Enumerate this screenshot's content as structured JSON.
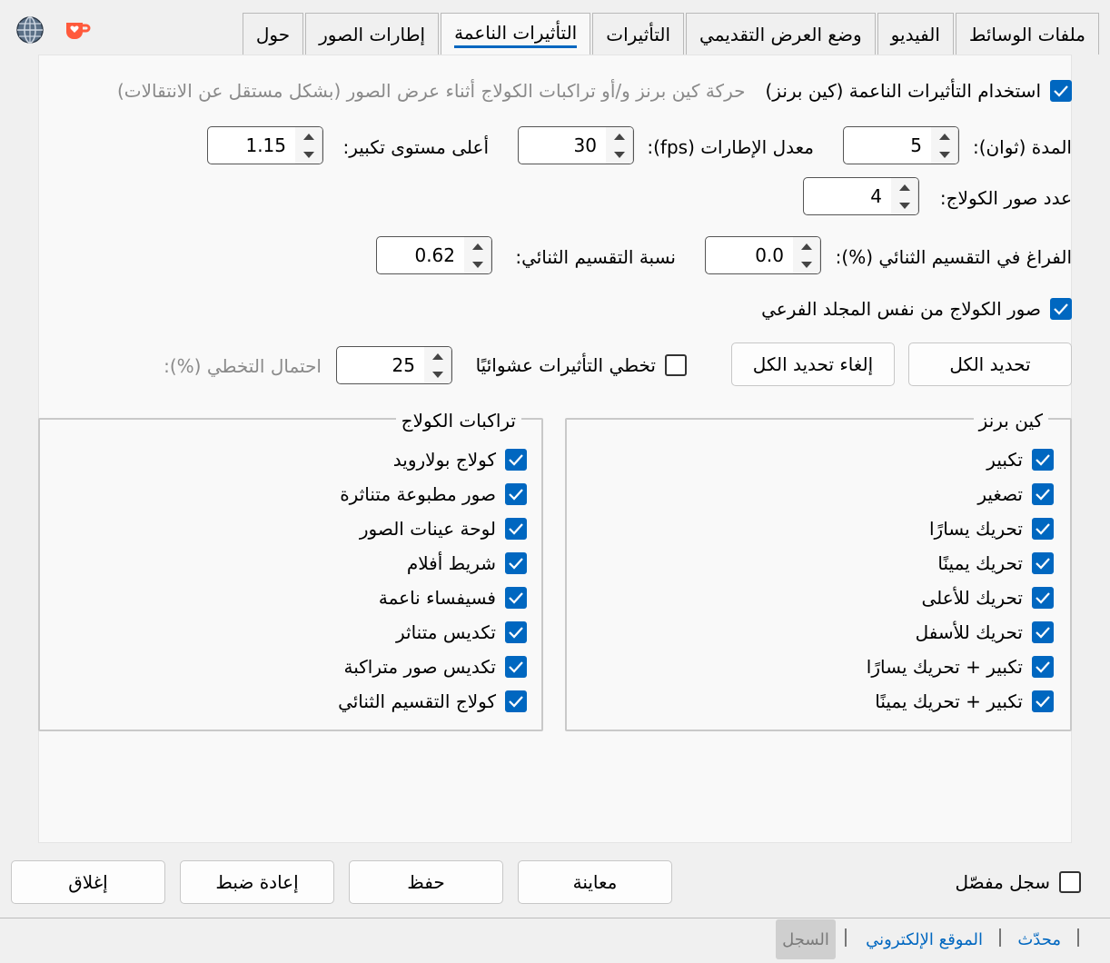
{
  "tabs": [
    {
      "label": "ملفات الوسائط",
      "active": false
    },
    {
      "label": "الفيديو",
      "active": false
    },
    {
      "label": "وضع العرض التقديمي",
      "active": false
    },
    {
      "label": "التأثيرات",
      "active": false
    },
    {
      "label": "التأثيرات الناعمة",
      "active": true
    },
    {
      "label": "إطارات الصور",
      "active": false
    },
    {
      "label": "حول",
      "active": false
    }
  ],
  "icons": {
    "globe": "globe-icon",
    "coffee": "coffee-heart-icon"
  },
  "smooth": {
    "use_label": "استخدام التأثيرات الناعمة (كين برنز)",
    "use_desc": "حركة كين برنز و/أو تراكبات الكولاج أثناء عرض الصور (بشكل مستقل عن الانتقالات)",
    "duration_label": "المدة (ثوان):",
    "duration_value": "5",
    "fps_label": "معدل الإطارات (fps):",
    "fps_value": "30",
    "zoom_label": "أعلى مستوى تكبير:",
    "zoom_value": "1.15",
    "collage_count_label": "عدد صور الكولاج:",
    "collage_count_value": "4",
    "split_gap_label": "الفراغ في التقسيم الثنائي (%):",
    "split_gap_value": "0.0",
    "split_ratio_label": "نسبة التقسيم الثنائي:",
    "split_ratio_value": "0.62",
    "same_folder_label": "صور الكولاج من نفس المجلد الفرعي",
    "select_all": "تحديد الكل",
    "deselect_all": "إلغاء تحديد الكل",
    "random_skip_label": "تخطي التأثيرات عشوائيًا",
    "skip_value": "25",
    "skip_prob_label": "احتمال التخطي (%):"
  },
  "kenburns": {
    "title": "كين برنز",
    "items": [
      "تكبير",
      "تصغير",
      "تحريك يسارًا",
      "تحريك يمينًا",
      "تحريك للأعلى",
      "تحريك للأسفل",
      "تكبير + تحريك يسارًا",
      "تكبير + تحريك يمينًا"
    ]
  },
  "collage": {
    "title": "تراكبات الكولاج",
    "items": [
      "كولاج بولارويد",
      "صور مطبوعة متناثرة",
      "لوحة عينات الصور",
      "شريط أفلام",
      "فسيفساء ناعمة",
      "تكديس متناثر",
      "تكديس صور متراكبة",
      "كولاج التقسيم الثنائي"
    ]
  },
  "bottom": {
    "verbose_log": "سجل مفصّل",
    "preview": "معاينة",
    "save": "حفظ",
    "reset": "إعادة ضبط",
    "close": "إغلاق"
  },
  "footer": {
    "updated": "محدّث",
    "website": "الموقع الإلكتروني",
    "log": "السجل"
  },
  "colors": {
    "accent": "#0067c0",
    "link": "#0067c0"
  }
}
